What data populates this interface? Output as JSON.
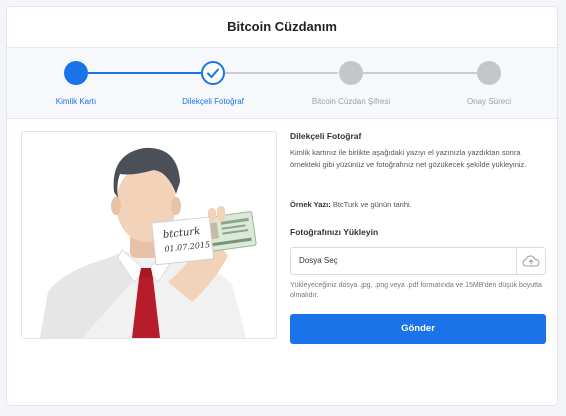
{
  "page": {
    "title": "Bitcoin Cüzdanım"
  },
  "steps": [
    {
      "label": "Kimlik Kartı",
      "state": "done"
    },
    {
      "label": "Dilekçeli Fotoğraf",
      "state": "current"
    },
    {
      "label": "Bitcoin Cüzdan Şifresi",
      "state": "pending"
    },
    {
      "label": "Onay Süreci",
      "state": "pending"
    }
  ],
  "illustration": {
    "sign_line1": "btcturk",
    "sign_line2": "01.07.2015"
  },
  "info": {
    "heading": "Dilekçeli Fotoğraf",
    "description": "Kimlik kartınız ile birlikte aşağıdaki yazıyı el yazınızla yazdıktan sonra örnekteki gibi yüzünüz ve fotoğrafınız net gözükecek şekilde yükleyiniz.",
    "sample_label": "Örnek Yazı:",
    "sample_text": "BtcTurk ve günün tarihi."
  },
  "upload": {
    "title": "Fotoğrafınızı Yükleyin",
    "choose_label": "Dosya Seç",
    "icon": "cloud-upload-icon",
    "note": "Yükleyeceğiniz dosya .jpg, .png veya .pdf formatında ve 15MB'den düşük boyutta olmalıdır.",
    "submit_label": "Gönder"
  },
  "colors": {
    "accent": "#1a73e8",
    "pending": "#c4c6ca"
  }
}
